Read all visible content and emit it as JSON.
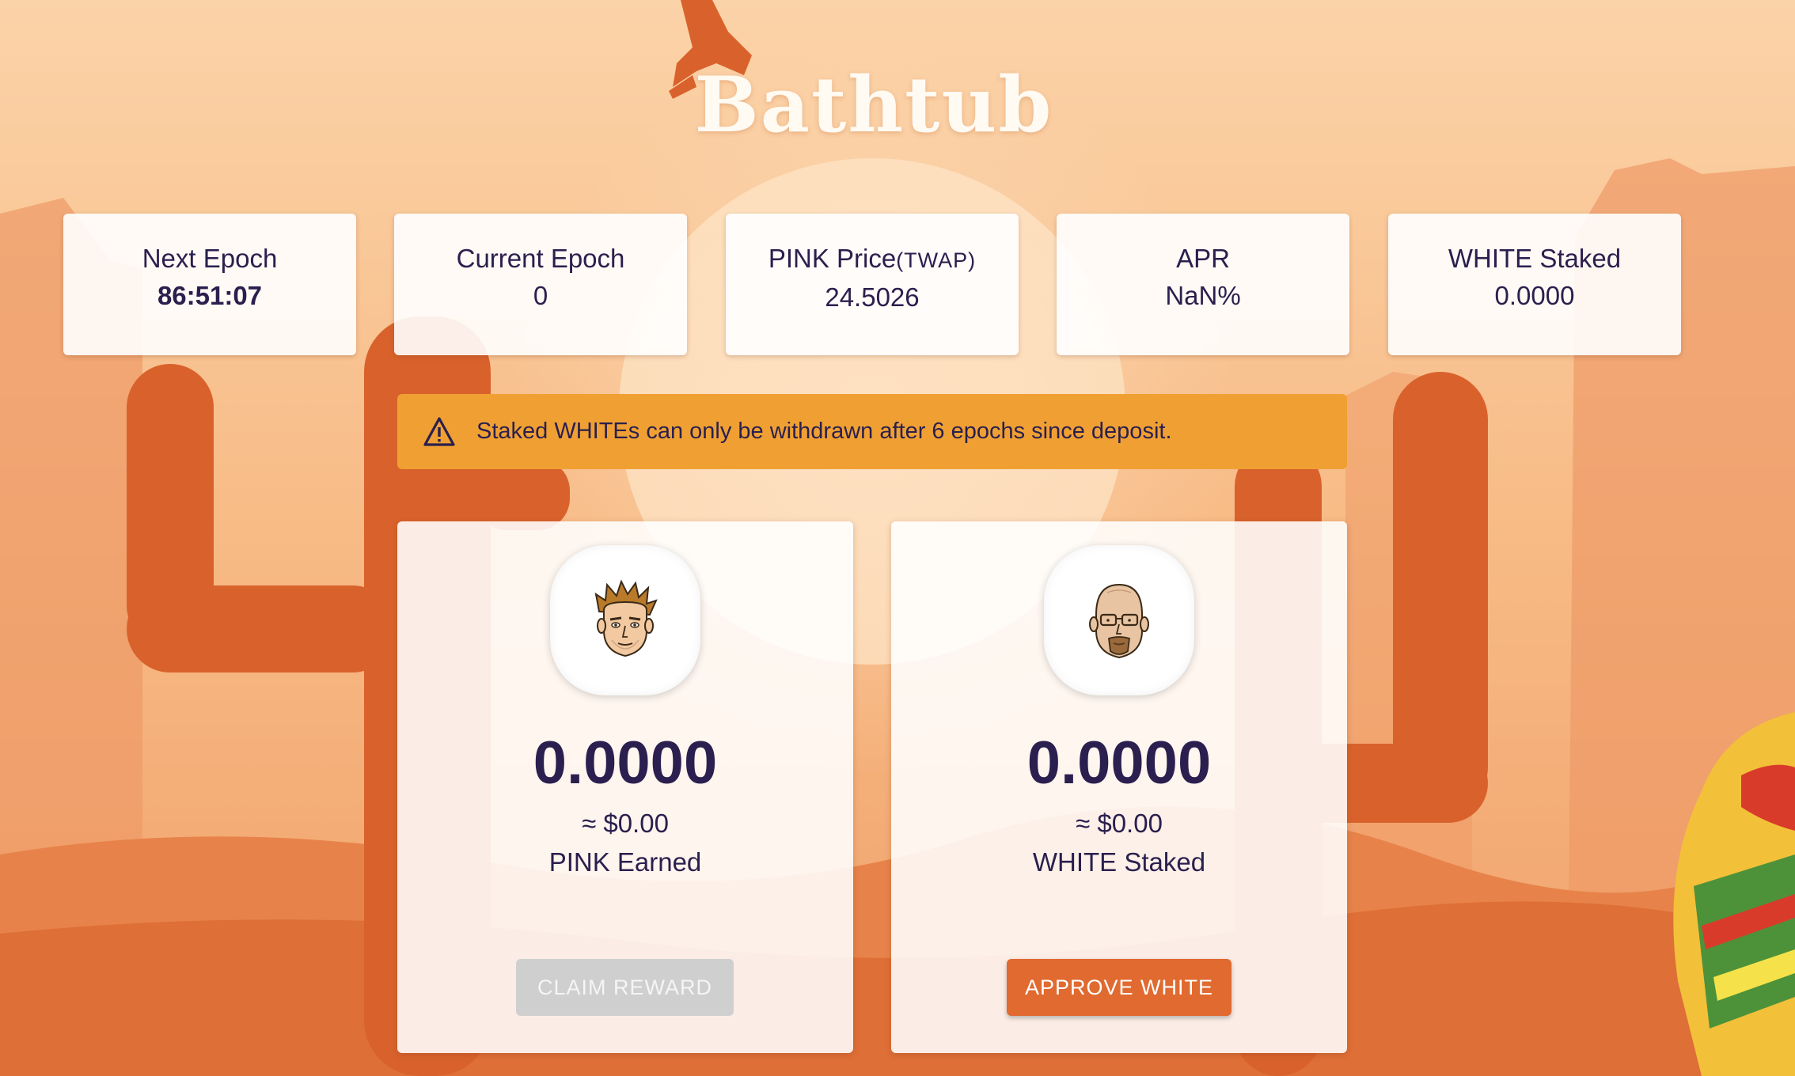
{
  "title": "Bathtub",
  "stats": {
    "next_epoch": {
      "label": "Next Epoch",
      "value": "86:51:07"
    },
    "current_epoch": {
      "label": "Current Epoch",
      "value": "0"
    },
    "pink_price": {
      "label": "PINK Price",
      "label_suffix": "(TWAP)",
      "value": "24.5026"
    },
    "apr": {
      "label": "APR",
      "value": "NaN%"
    },
    "white_staked": {
      "label": "WHITE Staked",
      "value": "0.0000"
    }
  },
  "alert": {
    "icon": "warning-triangle-icon",
    "text": "Staked WHITEs can only be withdrawn after 6 epochs since deposit."
  },
  "earned_card": {
    "avatar": "blond-man-face-icon",
    "value": "0.0000",
    "usd": "≈ $0.00",
    "label": "PINK Earned",
    "button_label": "CLAIM REWARD",
    "button_disabled": true
  },
  "staked_card": {
    "avatar": "bald-bearded-man-face-icon",
    "value": "0.0000",
    "usd": "≈ $0.00",
    "label": "WHITE Staked",
    "button_label": "APPROVE WHITE"
  },
  "colors": {
    "background": "#f6b27a",
    "cactus": "#d9622c",
    "alert": "#f0a033",
    "primary_button": "#e06a30",
    "disabled_button": "#cfcfcf",
    "text": "#2a1f4e"
  }
}
